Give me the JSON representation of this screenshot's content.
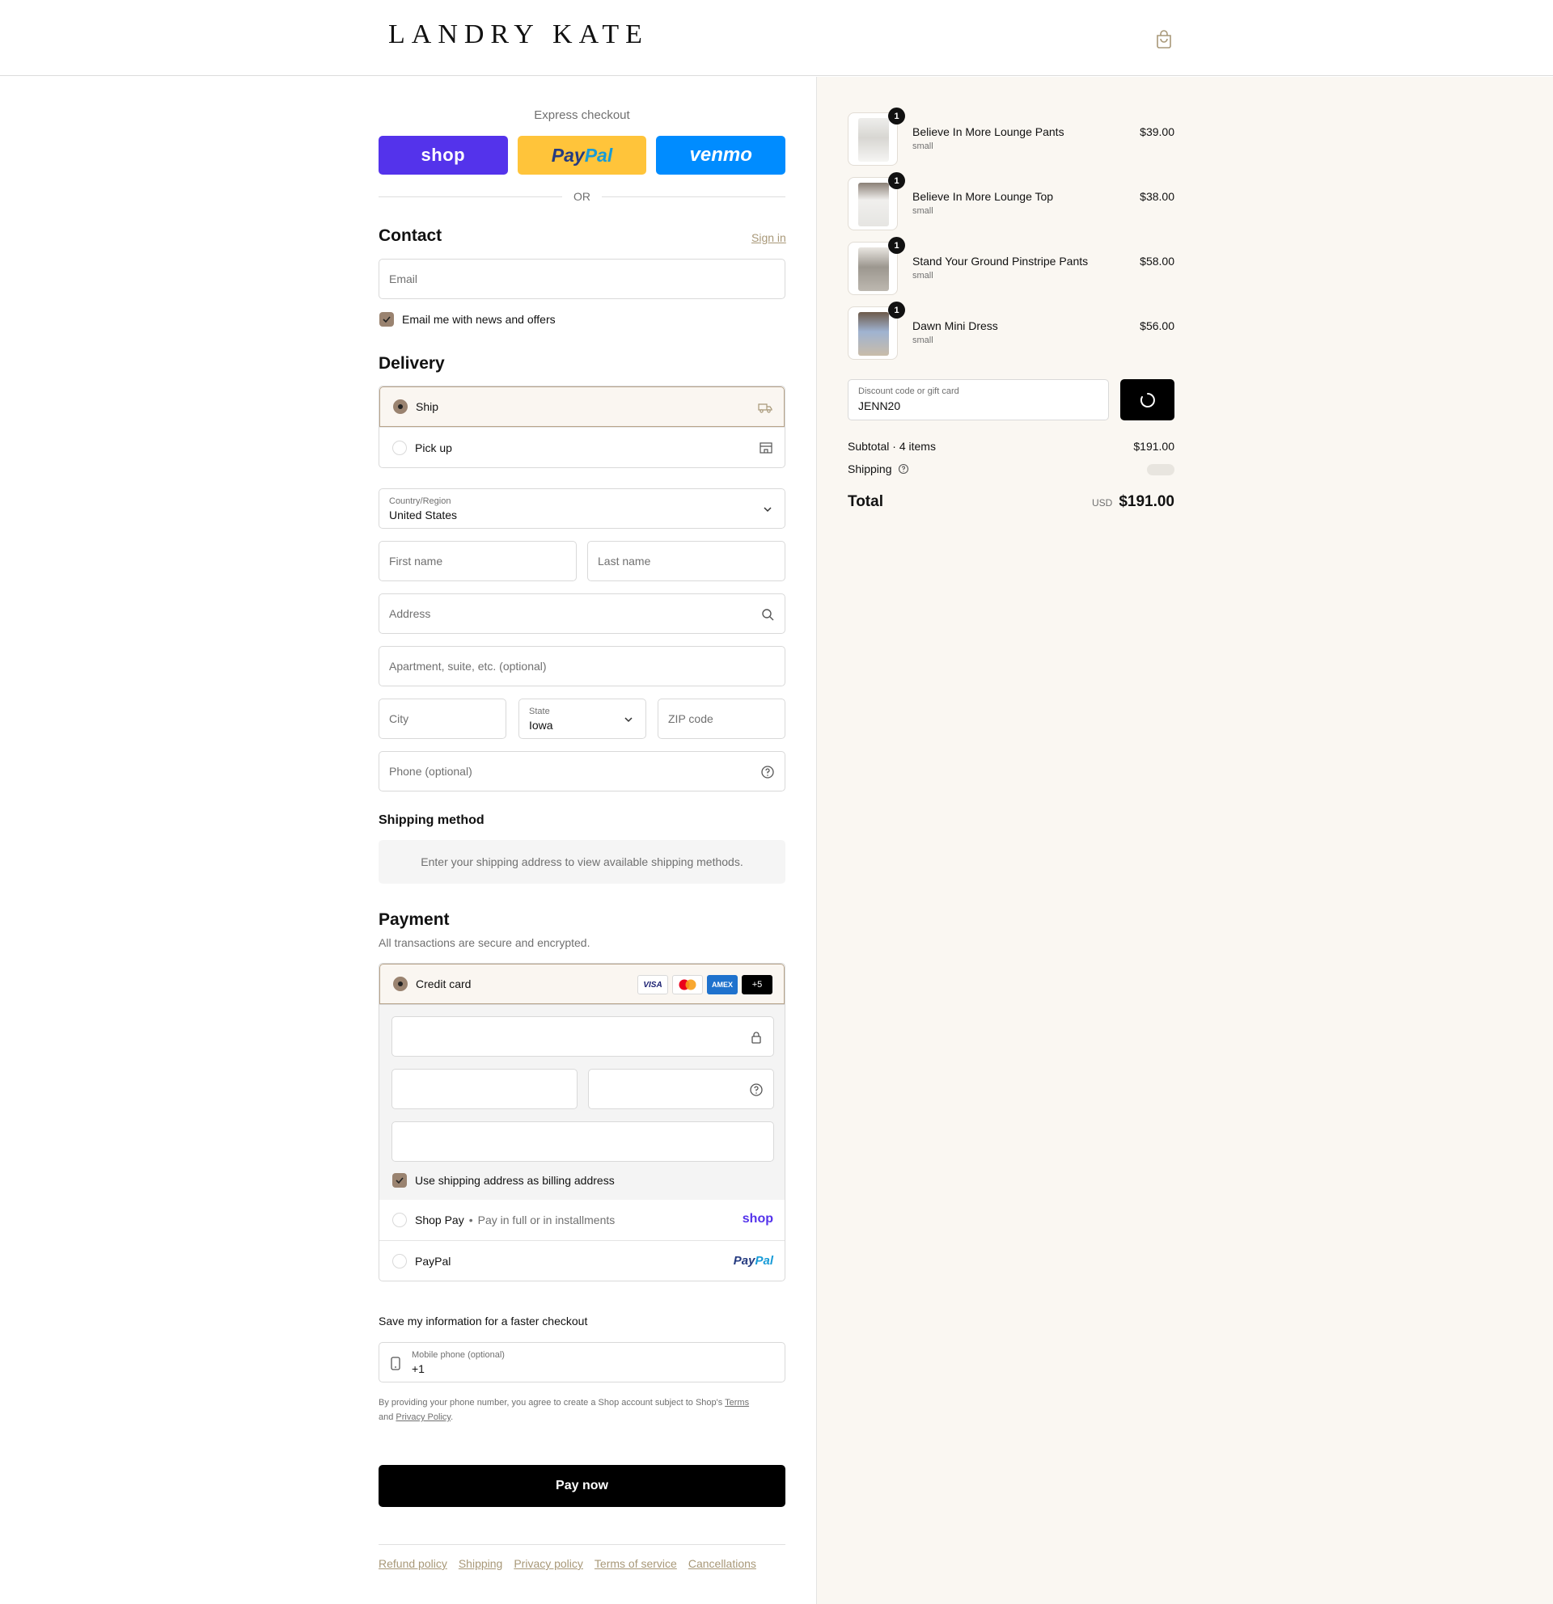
{
  "header": {
    "logo": "LANDRY KATE"
  },
  "express": {
    "title": "Express checkout",
    "shop_label": "shop",
    "paypal_part1": "Pay",
    "paypal_part2": "Pal",
    "venmo_label": "venmo",
    "or_label": "OR"
  },
  "contact": {
    "heading": "Contact",
    "sign_in": "Sign in",
    "email_placeholder": "Email",
    "news_label": "Email me with news and offers",
    "news_checked": true
  },
  "delivery": {
    "heading": "Delivery",
    "options": [
      {
        "label": "Ship",
        "selected": true,
        "icon": "truck-icon"
      },
      {
        "label": "Pick up",
        "selected": false,
        "icon": "store-icon"
      }
    ],
    "country_label": "Country/Region",
    "country_value": "United States",
    "first_name": "First name",
    "last_name": "Last name",
    "address": "Address",
    "apartment": "Apartment, suite, etc. (optional)",
    "city": "City",
    "state_label": "State",
    "state_value": "Iowa",
    "zip": "ZIP code",
    "phone": "Phone (optional)"
  },
  "shipping_method": {
    "heading": "Shipping method",
    "info": "Enter your shipping address to view available shipping methods."
  },
  "payment": {
    "heading": "Payment",
    "note": "All transactions are secure and encrypted.",
    "credit_card_label": "Credit card",
    "card_logos": [
      "VISA",
      "MC",
      "AMEX",
      "+5"
    ],
    "billing_label": "Use shipping address as billing address",
    "shop_pay_label": "Shop Pay",
    "shop_pay_note": "Pay in full or in installments",
    "shop_pay_logo": "shop",
    "paypal_label": "PayPal",
    "paypal_logo_1": "Pay",
    "paypal_logo_2": "Pal"
  },
  "save_info": {
    "title": "Save my information for a faster checkout",
    "mobile_label": "Mobile phone (optional)",
    "mobile_value": "+1",
    "legal_prefix": "By providing your phone number, you agree to create a Shop account subject to Shop's",
    "terms_link": "Terms",
    "legal_and": "and",
    "privacy_link": "Privacy Policy",
    "legal_end": "."
  },
  "pay_now": "Pay now",
  "footer_links": [
    "Refund policy",
    "Shipping",
    "Privacy policy",
    "Terms of service",
    "Cancellations"
  ],
  "order": {
    "items": [
      {
        "name": "Believe In More Lounge Pants",
        "variant": "small",
        "price": "$39.00",
        "qty": "1"
      },
      {
        "name": "Believe In More Lounge Top",
        "variant": "small",
        "price": "$38.00",
        "qty": "1"
      },
      {
        "name": "Stand Your Ground Pinstripe Pants",
        "variant": "small",
        "price": "$58.00",
        "qty": "1"
      },
      {
        "name": "Dawn Mini Dress",
        "variant": "small",
        "price": "$56.00",
        "qty": "1"
      }
    ],
    "discount_label": "Discount code or gift card",
    "discount_value": "JENN20",
    "subtotal_label": "Subtotal · 4 items",
    "subtotal_value": "$191.00",
    "shipping_label": "Shipping",
    "total_label": "Total",
    "currency": "USD",
    "total_value": "$191.00"
  },
  "colors": {
    "accent": "#9a8370",
    "shop_purple": "#5433eb",
    "paypal_yellow": "#ffc43a",
    "venmo_blue": "#008cff",
    "link": "#a89878",
    "summary_bg": "#faf7f2"
  }
}
